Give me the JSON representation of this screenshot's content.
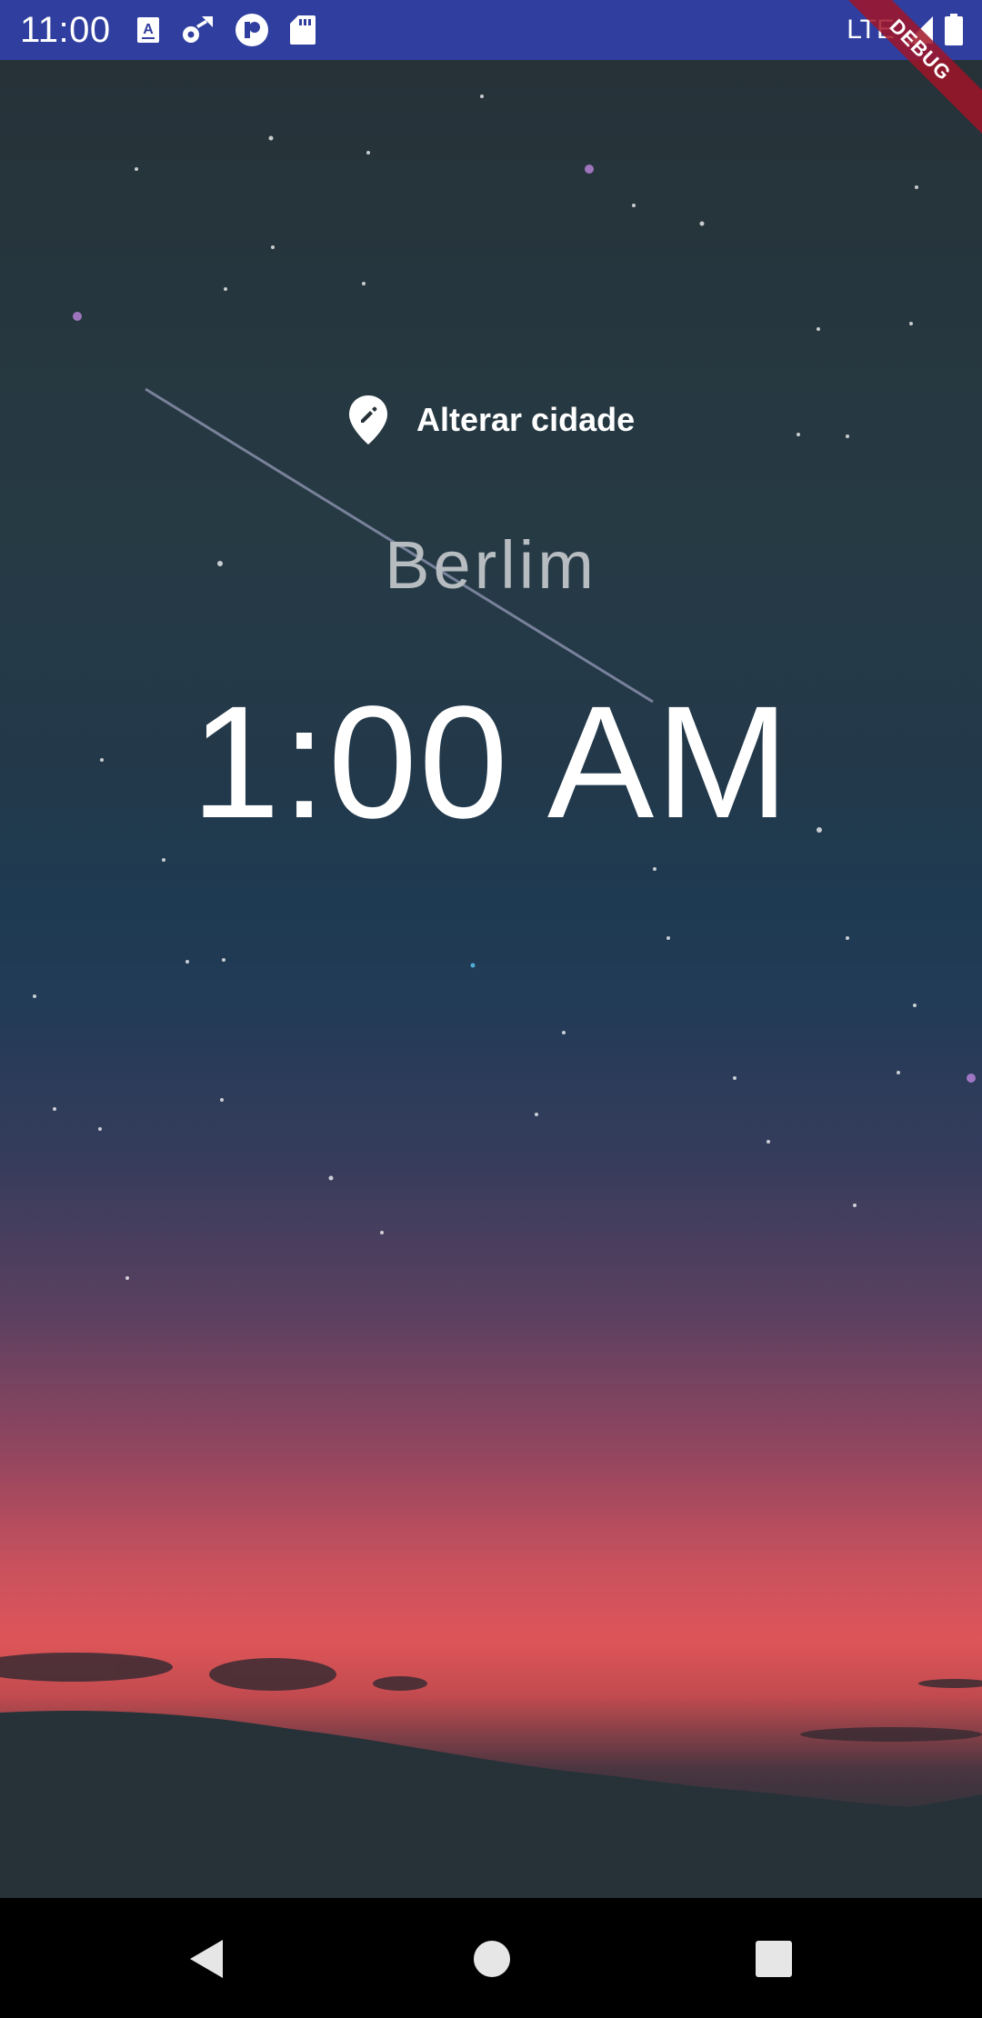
{
  "status_bar": {
    "time": "11:00",
    "network": "LTE",
    "icons": [
      "a-keyboard-icon",
      "settings-sync-icon",
      "vpn-key-icon",
      "sd-card-icon",
      "signal-icon",
      "battery-icon"
    ],
    "background_color": "#303f9f"
  },
  "debug_banner": {
    "label": "DEBUG"
  },
  "main": {
    "change_city_label": "Alterar cidade",
    "change_city_icon": "edit-location-icon",
    "city_name": "Berlim",
    "time": "1:00 AM"
  },
  "nav_bar": {
    "buttons": [
      "back-icon",
      "home-icon",
      "recents-icon"
    ]
  }
}
